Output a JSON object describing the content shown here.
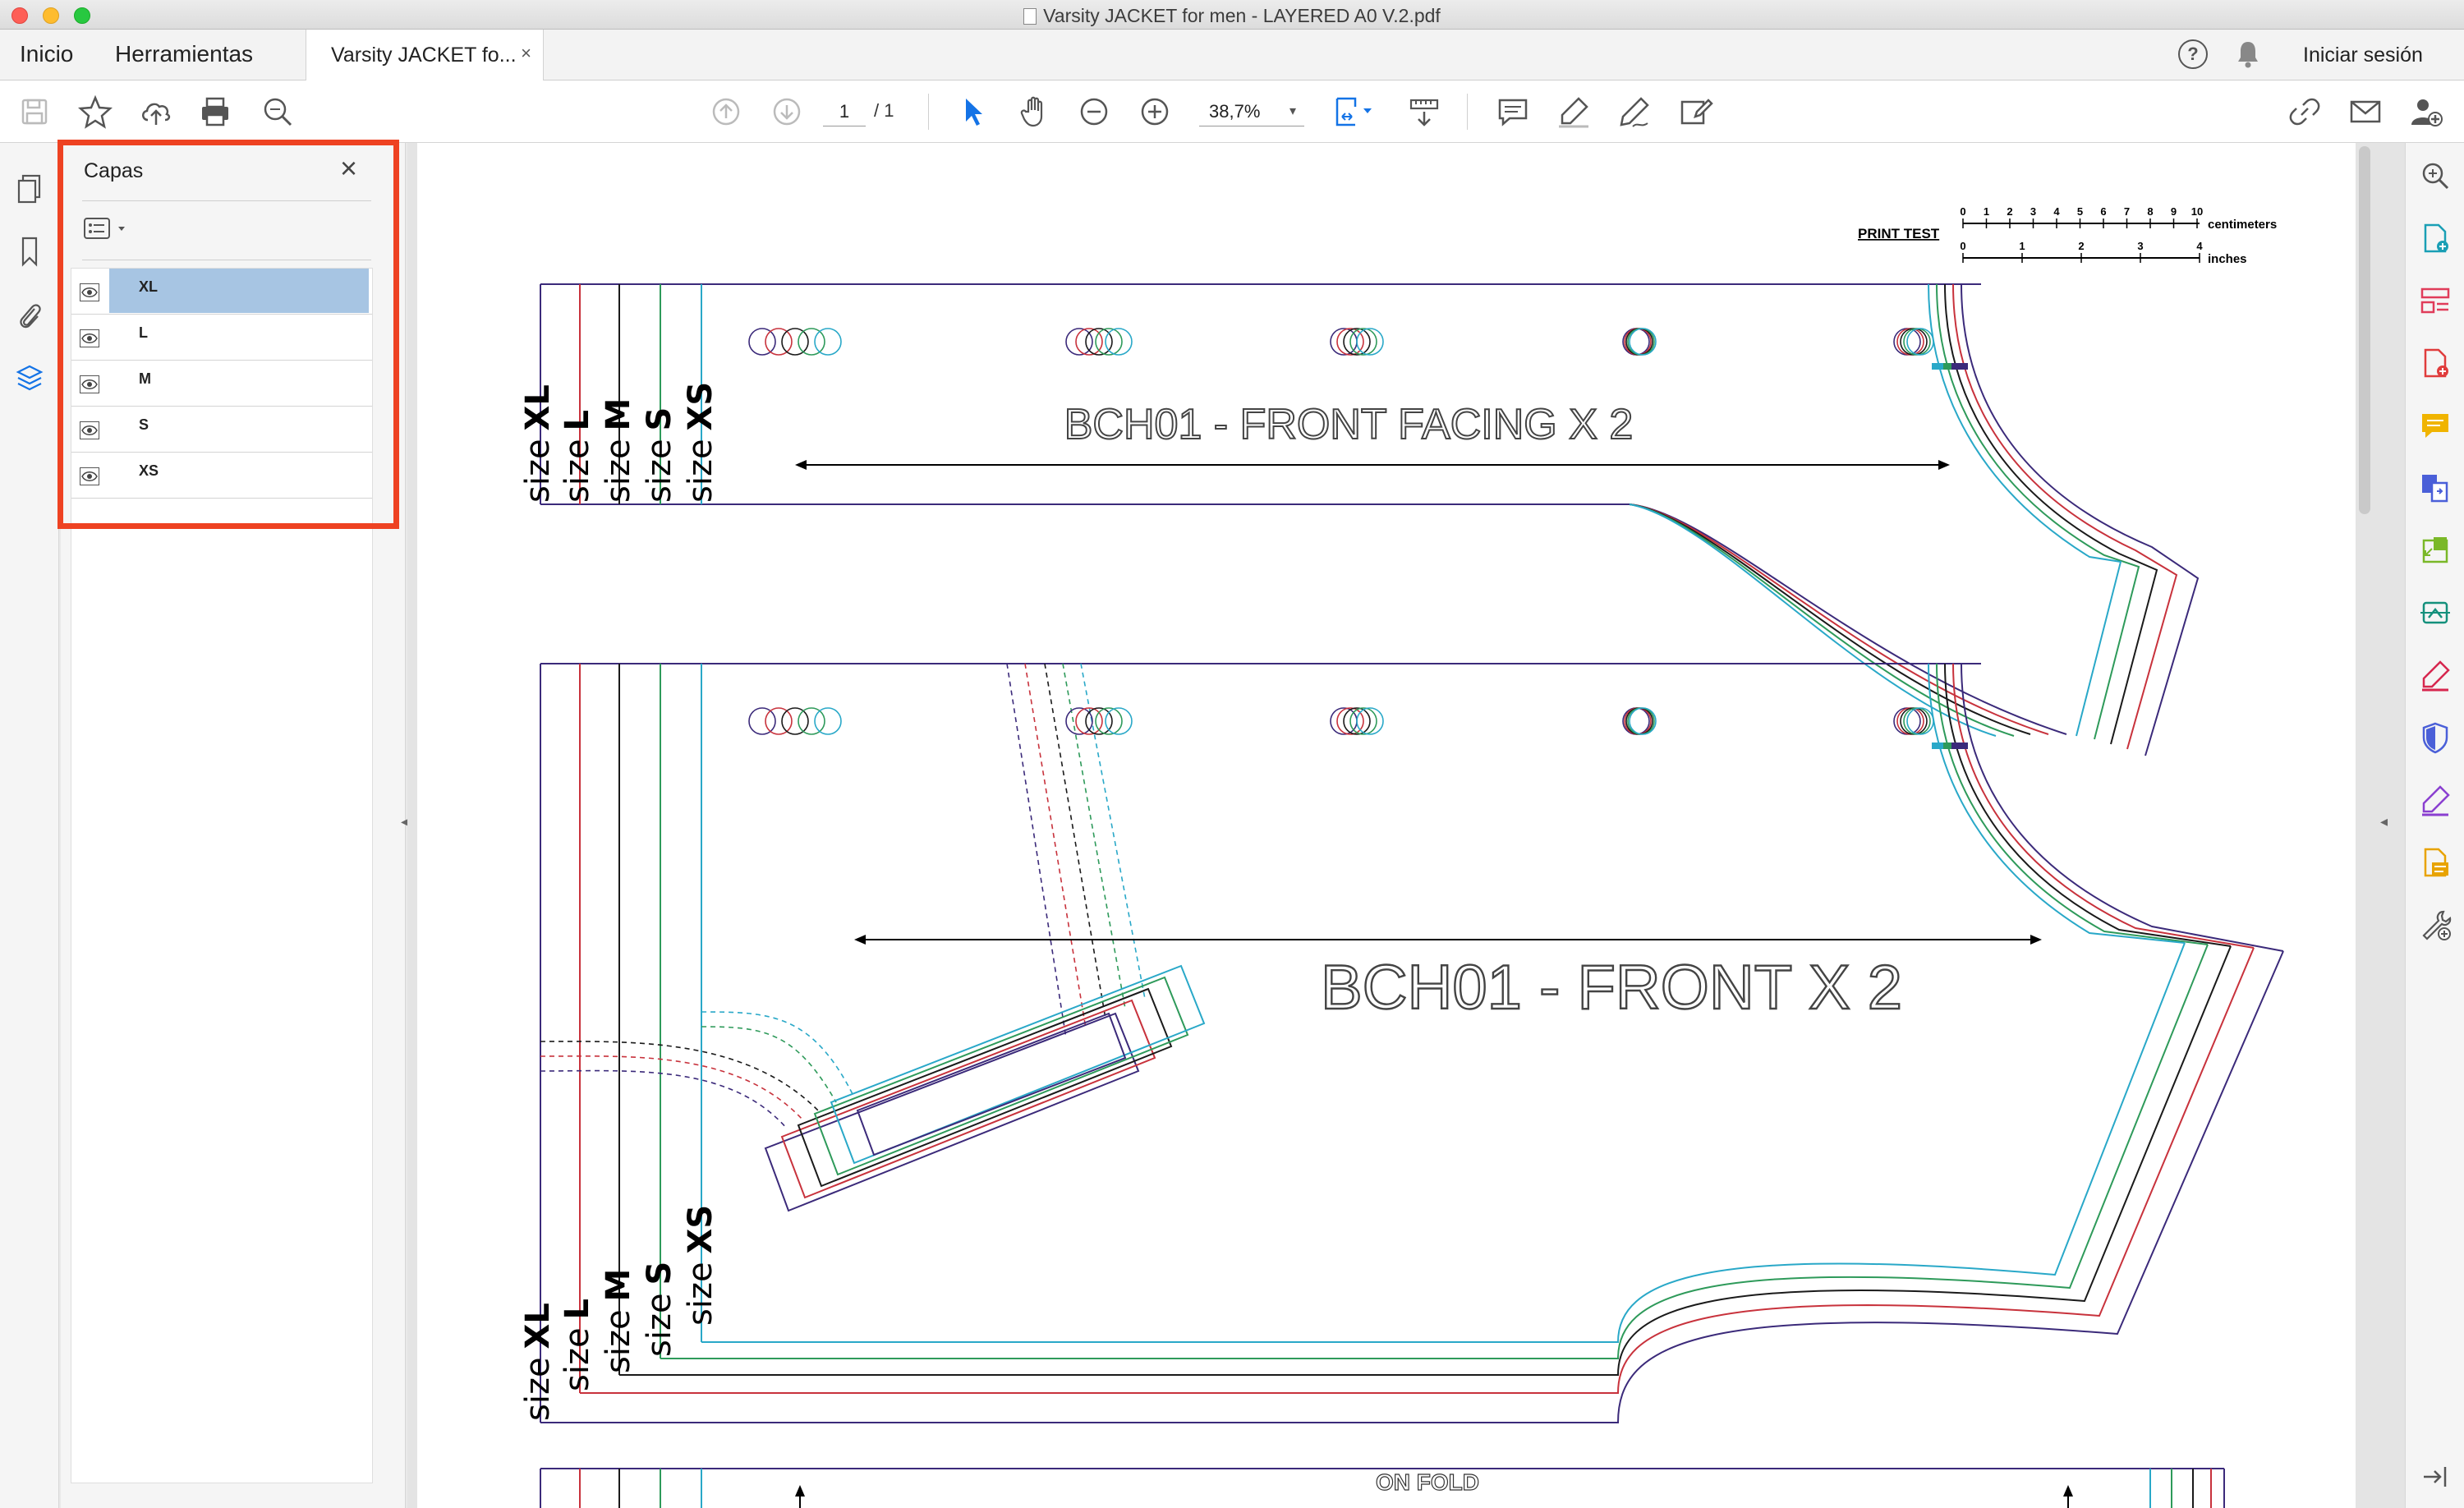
{
  "window": {
    "title": "Varsity JACKET for men - LAYERED A0 V.2.pdf"
  },
  "tabs": {
    "home": "Inicio",
    "tools": "Herramientas",
    "document": "Varsity JACKET fo...",
    "document_close": "×",
    "help": "?",
    "sign_in": "Iniciar sesión"
  },
  "toolbar": {
    "page_current": "1",
    "page_total": "/  1",
    "zoom": "38,7%",
    "zoom_caret": "▾"
  },
  "layers_panel": {
    "title": "Capas",
    "close": "×",
    "layers": [
      {
        "name": "XL",
        "selected": true
      },
      {
        "name": "L",
        "selected": false
      },
      {
        "name": "M",
        "selected": false
      },
      {
        "name": "S",
        "selected": false
      },
      {
        "name": "XS",
        "selected": false
      }
    ]
  },
  "document": {
    "print_test": {
      "label": "PRINT TEST",
      "cm_ticks": [
        "0",
        "1",
        "2",
        "3",
        "4",
        "5",
        "6",
        "7",
        "8",
        "9",
        "10"
      ],
      "cm_label": "centimeters",
      "in_ticks": [
        "0",
        "1",
        "2",
        "3",
        "4"
      ],
      "in_label": "inches"
    },
    "piece1": {
      "title": "BCH01 - FRONT FACING  X 2",
      "size_prefix": "size",
      "sizes": [
        "XL",
        "L",
        "M",
        "S",
        "XS"
      ]
    },
    "piece2": {
      "title": "BCH01 - FRONT X 2",
      "size_prefix": "size",
      "sizes": [
        "XL",
        "L",
        "M",
        "S",
        "XS"
      ]
    },
    "piece3": {
      "label": "ON FOLD"
    },
    "size_colors": {
      "XL": "#3b2a7a",
      "L": "#c8323c",
      "M": "#1a1a1a",
      "S": "#2e9a5a",
      "XS": "#29a8c8"
    }
  },
  "collapse": {
    "left": "◂",
    "right": "◂"
  }
}
